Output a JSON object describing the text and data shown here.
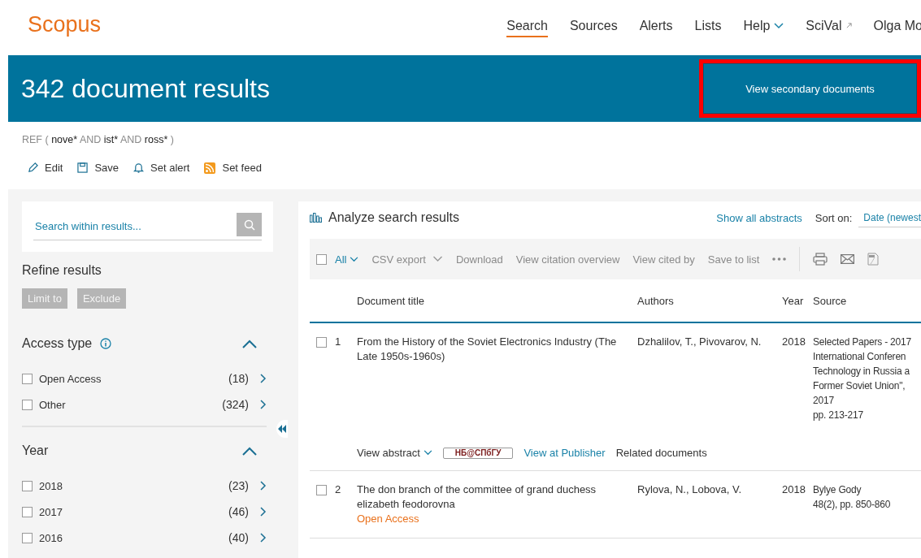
{
  "nav": {
    "logo": "Scopus",
    "items": [
      {
        "label": "Search",
        "selected": true,
        "kind": "plain"
      },
      {
        "label": "Sources",
        "selected": false,
        "kind": "plain"
      },
      {
        "label": "Alerts",
        "selected": false,
        "kind": "plain"
      },
      {
        "label": "Lists",
        "selected": false,
        "kind": "plain"
      },
      {
        "label": "Help",
        "selected": false,
        "kind": "dropdown"
      },
      {
        "label": "SciVal",
        "selected": false,
        "kind": "external"
      }
    ],
    "user": "Olga Mo"
  },
  "banner": {
    "title": "342 document results",
    "button": "View secondary documents",
    "highlighted": true
  },
  "query": [
    {
      "text": "REF (",
      "kind": "operator"
    },
    {
      "text": "nove*",
      "kind": "term"
    },
    {
      "text": "AND",
      "kind": "operator"
    },
    {
      "text": "ist*",
      "kind": "term"
    },
    {
      "text": "AND",
      "kind": "operator"
    },
    {
      "text": "ross*",
      "kind": "term"
    },
    {
      "text": ")",
      "kind": "operator"
    }
  ],
  "actions": [
    {
      "label": "Edit"
    },
    {
      "label": "Save"
    },
    {
      "label": "Set alert"
    },
    {
      "label": "Set feed"
    }
  ],
  "sidebar": {
    "search_placeholder": "Search within results...",
    "refine_title": "Refine results",
    "buttons": [
      "Limit to",
      "Exclude"
    ],
    "facets": [
      {
        "title": "Access type",
        "info": true,
        "expanded": true,
        "options": [
          {
            "label": "Open Access",
            "count": "(18)",
            "checked": false
          },
          {
            "label": "Other",
            "count": "(324)",
            "checked": false
          }
        ]
      },
      {
        "title": "Year",
        "info": false,
        "expanded": true,
        "options": [
          {
            "label": "2018",
            "count": "(23)",
            "checked": false
          },
          {
            "label": "2017",
            "count": "(46)",
            "checked": false
          },
          {
            "label": "2016",
            "count": "(40)",
            "checked": false
          }
        ]
      }
    ]
  },
  "results": {
    "analyze": "Analyze search results",
    "show_abstracts": "Show all abstracts",
    "sort_label": "Sort on:",
    "sort_value": "Date (newest",
    "toolbar": {
      "all_label": "All",
      "all_checked": false,
      "actions": [
        {
          "label": "CSV export",
          "kind": "dropdown"
        },
        {
          "label": "Download",
          "kind": "plain"
        },
        {
          "label": "View citation overview",
          "kind": "plain"
        },
        {
          "label": "View cited by",
          "kind": "plain"
        },
        {
          "label": "Save to list",
          "kind": "plain"
        }
      ]
    },
    "columns": [
      "Document title",
      "Authors",
      "Year",
      "Source"
    ],
    "rows": [
      {
        "number": "1",
        "checked": false,
        "title": "From the History of the Soviet Electronics Industry (The Late 1950s-1960s)",
        "authors": "Dzhalilov, T., Pivovarov, N.",
        "year": "2018",
        "source_lines": [
          "Selected Papers - 2017",
          "International Conferen",
          "Technology in Russia a",
          "Former Soviet Union\",",
          "2017",
          "pp. 213-217"
        ],
        "links": {
          "abstract": "View abstract",
          "library": "НБ@СПбГУ",
          "publisher": "View at Publisher",
          "related": "Related documents"
        }
      },
      {
        "number": "2",
        "checked": false,
        "title": "The don branch of the committee of grand duchess elizabeth feodorovna",
        "open_access_label": "Open Access",
        "authors": "Rylova, N., Lobova, V.",
        "year": "2018",
        "source_lines": [
          "Bylye Gody",
          "48(2), pp. 850-860"
        ]
      }
    ]
  }
}
